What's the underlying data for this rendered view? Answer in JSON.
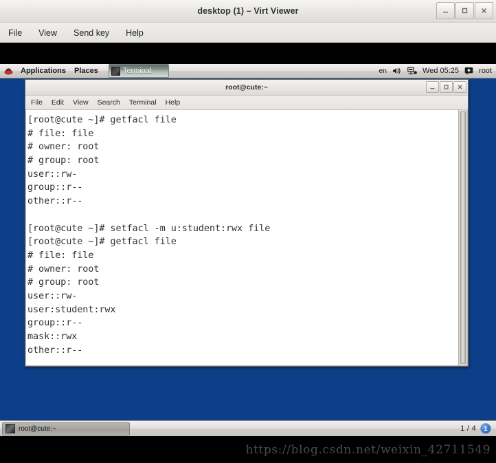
{
  "viewer_window": {
    "title": "desktop (1) – Virt Viewer",
    "controls": [
      {
        "name": "minimize",
        "glyph": "_"
      },
      {
        "name": "maximize",
        "glyph": "□"
      },
      {
        "name": "close",
        "glyph": "×"
      }
    ],
    "menu": [
      "File",
      "View",
      "Send key",
      "Help"
    ]
  },
  "gnome_panel": {
    "applications_label": "Applications",
    "places_label": "Places",
    "active_window_label": "Terminal",
    "language": "en",
    "clock": "Wed 05:25",
    "user": "root",
    "icons": {
      "logo": "redhat-logo-icon",
      "volume": "volume-icon",
      "network": "network-icon",
      "user_status": "user-status-icon"
    }
  },
  "terminal_window": {
    "title": "root@cute:~",
    "menu": [
      "File",
      "Edit",
      "View",
      "Search",
      "Terminal",
      "Help"
    ],
    "controls": [
      {
        "name": "minimize",
        "glyph": "_"
      },
      {
        "name": "maximize",
        "glyph": "□"
      },
      {
        "name": "close",
        "glyph": "×"
      }
    ],
    "lines": [
      "[root@cute ~]# getfacl file",
      "# file: file",
      "# owner: root",
      "# group: root",
      "user::rw-",
      "group::r--",
      "other::r--",
      "",
      "[root@cute ~]# setfacl -m u:student:rwx file",
      "[root@cute ~]# getfacl file",
      "# file: file",
      "# owner: root",
      "# group: root",
      "user::rw-",
      "user:student:rwx",
      "group::r--",
      "mask::rwx",
      "other::r--",
      ""
    ],
    "prompt": "[root@cute ~]# "
  },
  "taskbar": {
    "window_button_label": "root@cute:~",
    "workspace_pager": "1 / 4",
    "notification_count": "1"
  },
  "watermark": {
    "text": "https://blog.csdn.net/weixin_42711549"
  },
  "colors": {
    "desktop_background": "#0d3f89",
    "terminal_background": "#ffffff",
    "terminal_text": "#2e3436",
    "panel_background": "#e3e0dd"
  }
}
